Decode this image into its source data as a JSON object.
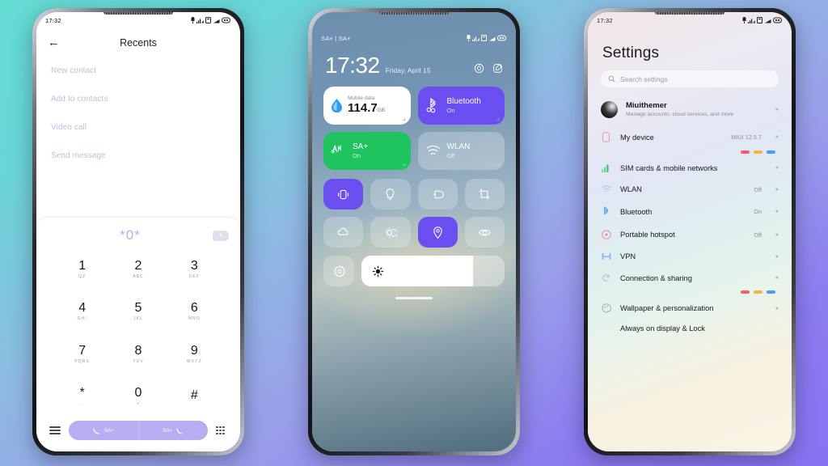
{
  "background": {
    "from": "#63dcd3",
    "to": "#8a72f2"
  },
  "statusbar": {
    "time": "17:32",
    "carriers": "SA+ | SA+"
  },
  "phone1": {
    "header": {
      "title": "Recents",
      "back_icon": "back-arrow-icon"
    },
    "menu_items": [
      "New contact",
      "Add to contacts",
      "Video call",
      "Send message"
    ],
    "dialer": {
      "number": "*0*",
      "keys": [
        {
          "num": "1",
          "sub": "QZ"
        },
        {
          "num": "2",
          "sub": "ABC"
        },
        {
          "num": "3",
          "sub": "DEF"
        },
        {
          "num": "4",
          "sub": "GHI"
        },
        {
          "num": "5",
          "sub": "JKL"
        },
        {
          "num": "6",
          "sub": "MNO"
        },
        {
          "num": "7",
          "sub": "PQRS"
        },
        {
          "num": "8",
          "sub": "TUV"
        },
        {
          "num": "9",
          "sub": "WXYZ"
        },
        {
          "num": "*",
          "sub": ","
        },
        {
          "num": "0",
          "sub": "+"
        },
        {
          "num": "#",
          "sub": ""
        }
      ],
      "call_sim1": "SA+",
      "call_sim2": "SA+",
      "pill_color": "#b6aef0"
    }
  },
  "phone2": {
    "clock": {
      "time": "17:32",
      "date": "Friday, April 15"
    },
    "cards": [
      {
        "title": "Mobile data",
        "value": "114.7",
        "unit": "GB",
        "style": "white",
        "icon": "water-drop-icon"
      },
      {
        "title": "Bluetooth",
        "state": "On",
        "style": "purple",
        "icon": "bluetooth-icon",
        "color": "#6a4ef0"
      },
      {
        "title": "SA+",
        "state": "On",
        "style": "green",
        "icon": "signal-tower-icon",
        "color": "#1fc360"
      },
      {
        "title": "WLAN",
        "state": "Off",
        "style": "glass",
        "icon": "wifi-icon"
      }
    ],
    "toggles": [
      {
        "name": "vibrate-icon",
        "on": true
      },
      {
        "name": "flashlight-icon",
        "on": false
      },
      {
        "name": "cast-icon",
        "on": false
      },
      {
        "name": "screenshot-icon",
        "on": false
      },
      {
        "name": "dnd-cloud-icon",
        "on": false
      },
      {
        "name": "auto-brightness-icon",
        "on": false
      },
      {
        "name": "location-icon",
        "on": true
      },
      {
        "name": "eye-comfort-icon",
        "on": false
      }
    ],
    "brightness": {
      "level": 78,
      "icon": "brightness-icon"
    },
    "settings_shortcut": "gear-icon"
  },
  "phone3": {
    "title": "Settings",
    "search_placeholder": "Search settings",
    "account": {
      "name": "Miuithemer",
      "desc": "Manage accounts, cloud services, and more"
    },
    "rows": [
      {
        "label": "My device",
        "value": "MIUI 12.5.7",
        "icon": "device-icon",
        "color": "#f09aa6"
      },
      {
        "label": "SIM cards & mobile networks",
        "value": "",
        "icon": "signal-bars-icon",
        "color": "#5ec98a"
      },
      {
        "label": "WLAN",
        "value": "Off",
        "icon": "wifi-icon",
        "color": "#9ec8e8"
      },
      {
        "label": "Bluetooth",
        "value": "On",
        "icon": "bluetooth-icon",
        "color": "#4aa3f0"
      },
      {
        "label": "Portable hotspot",
        "value": "Off",
        "icon": "hotspot-icon",
        "color": "#f18a9c"
      },
      {
        "label": "VPN",
        "value": "",
        "icon": "vpn-icon",
        "color": "#86b4ef"
      },
      {
        "label": "Connection & sharing",
        "value": "",
        "icon": "sharing-icon",
        "color": "#b8bcc6"
      },
      {
        "label": "Wallpaper & personalization",
        "value": "",
        "icon": "palette-icon",
        "color": "#7fc4b4"
      },
      {
        "label": "Always on display & Lock",
        "value": "",
        "icon": "lock-icon",
        "color": "#9aa0b4"
      }
    ],
    "dot_colors": [
      "#f2606f",
      "#f5b63e",
      "#4a9cf0"
    ]
  }
}
